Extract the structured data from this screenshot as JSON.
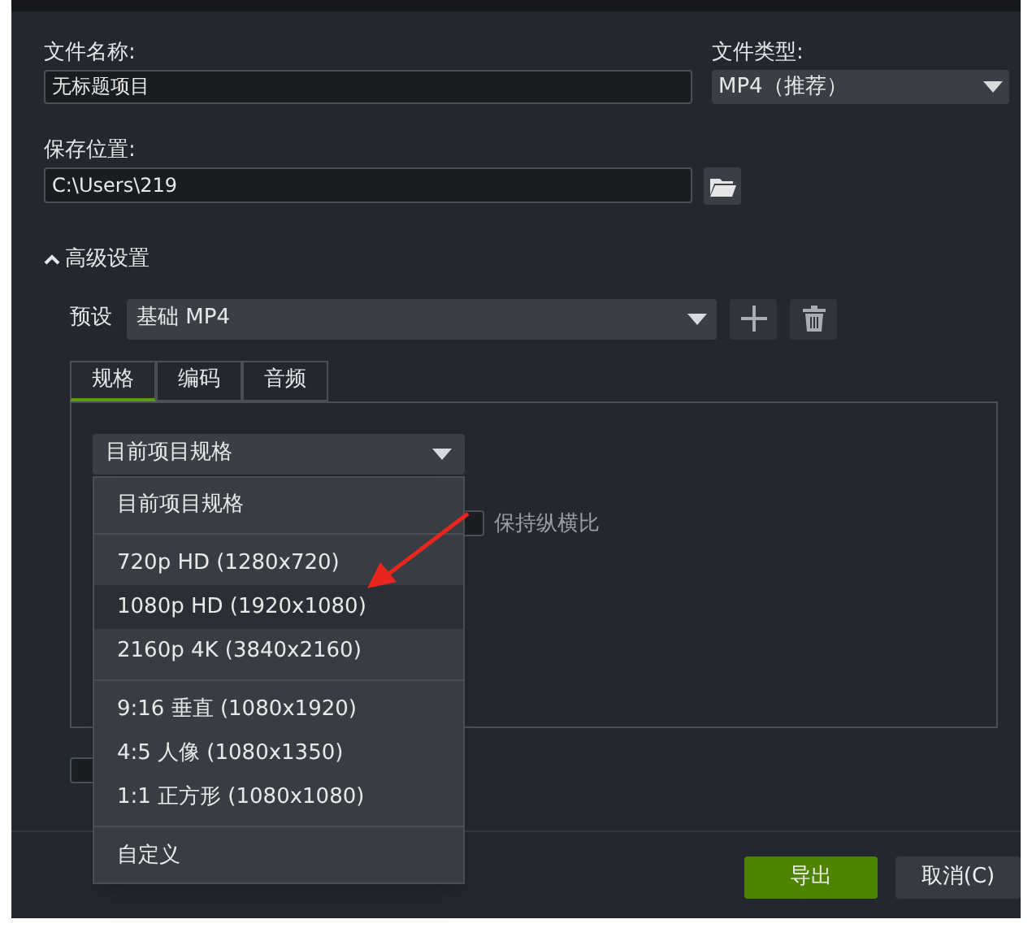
{
  "file_name": {
    "label": "文件名称:",
    "value": "无标题项目"
  },
  "file_type": {
    "label": "文件类型:",
    "value": "MP4（推荐）"
  },
  "save_location": {
    "label": "保存位置:",
    "value": "C:\\Users\\219"
  },
  "advanced": {
    "label": "高级设置",
    "expanded": true
  },
  "preset": {
    "label": "预设",
    "value": "基础 MP4"
  },
  "tabs": [
    {
      "label": "规格",
      "selected": true
    },
    {
      "label": "编码",
      "selected": false
    },
    {
      "label": "音频",
      "selected": false
    }
  ],
  "size_select": {
    "value": "目前项目规格"
  },
  "keep_aspect": {
    "label": "保持纵横比",
    "checked": false
  },
  "bottom_checkbox": {
    "checked": false
  },
  "size_menu": [
    {
      "kind": "item",
      "label": "目前项目规格",
      "selected": false
    },
    {
      "kind": "divider"
    },
    {
      "kind": "item",
      "label": "720p HD (1280x720)",
      "selected": false
    },
    {
      "kind": "item",
      "label": "1080p HD (1920x1080)",
      "selected": true
    },
    {
      "kind": "item",
      "label": "2160p 4K (3840x2160)",
      "selected": false
    },
    {
      "kind": "divider"
    },
    {
      "kind": "item",
      "label": "9:16 垂直 (1080x1920)",
      "selected": false
    },
    {
      "kind": "item",
      "label": "4:5 人像 (1080x1350)",
      "selected": false
    },
    {
      "kind": "item",
      "label": "1:1 正方形 (1080x1080)",
      "selected": false
    },
    {
      "kind": "divider"
    },
    {
      "kind": "item",
      "label": "自定义",
      "selected": false
    }
  ],
  "buttons": [
    {
      "label": "导出",
      "kind": "primary"
    },
    {
      "label": "取消(C)",
      "kind": "secondary"
    }
  ]
}
